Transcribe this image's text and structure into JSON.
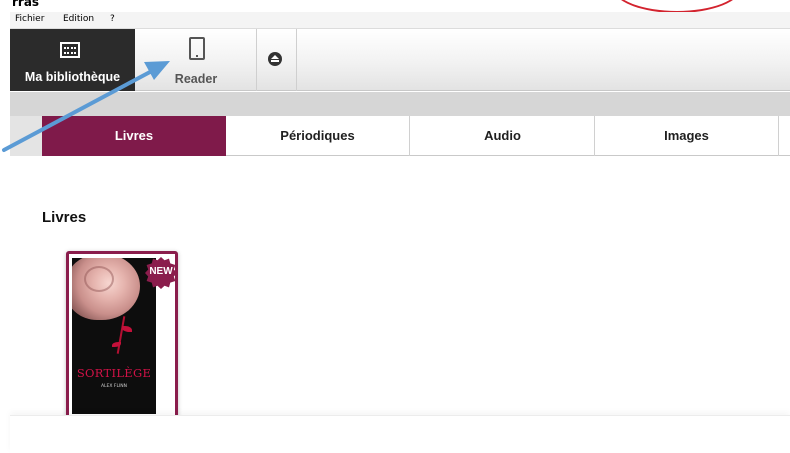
{
  "window": {
    "title_fragment": "rras"
  },
  "menubar": {
    "items": [
      "Fichier",
      "Edition",
      "?"
    ]
  },
  "toolbar": {
    "library_label": "Ma bibliothèque",
    "reader_label": "Reader",
    "library_icon": "library-grid-icon",
    "reader_icon": "tablet-icon",
    "eject_icon": "eject-icon"
  },
  "tabs": [
    {
      "label": "Livres",
      "active": true
    },
    {
      "label": "Périodiques",
      "active": false
    },
    {
      "label": "Audio",
      "active": false
    },
    {
      "label": "Images",
      "active": false
    }
  ],
  "content": {
    "section_title": "Livres",
    "books": [
      {
        "cover_title": "SORTILÈGE",
        "cover_author": "ALEX FLINN",
        "badge": "NEW"
      }
    ]
  },
  "colors": {
    "accent": "#7f1a4a",
    "annotation_arrow": "#5b9bd5",
    "annotation_oval": "#d3232e",
    "library_button_bg": "#2b2b2b"
  }
}
